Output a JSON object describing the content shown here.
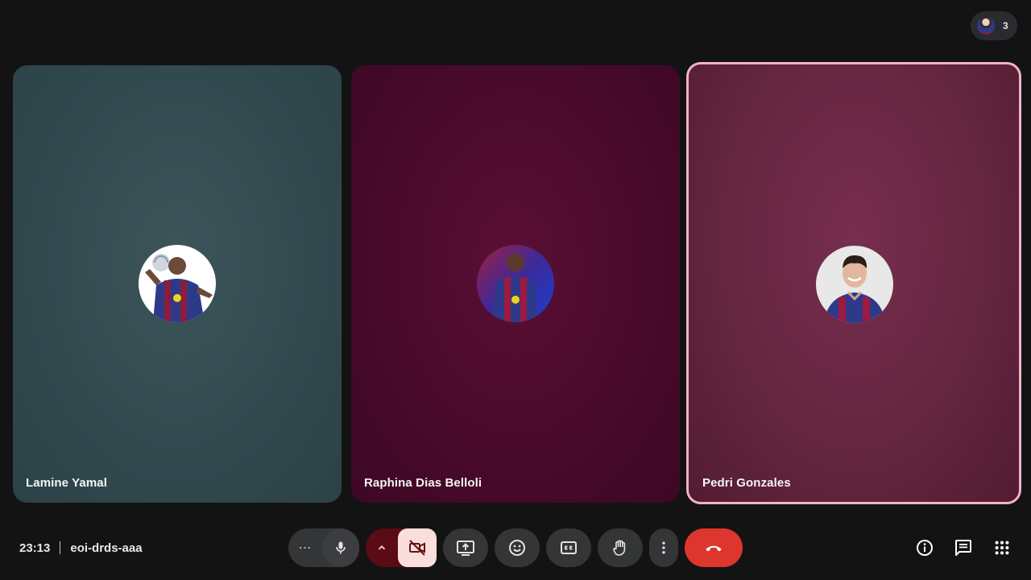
{
  "participants_chip": {
    "count": "3",
    "icon": "participant-avatar"
  },
  "tiles": [
    {
      "name": "Lamine Yamal",
      "background": "#324a4f",
      "jersey": [
        "#2d3a8a",
        "#8a1c3c"
      ],
      "avatar_bg": "#ffffff",
      "skin": "#6b4a3a"
    },
    {
      "name": "Raphina Dias Belloli",
      "background": "#4a0a2b",
      "jersey": [
        "#2d3a8a",
        "#a0193f"
      ],
      "avatar_bg": "#2e46c8",
      "skin": "#5a3a2c"
    },
    {
      "name": "Pedri Gonzales",
      "background": "#652640",
      "border": "#f2b3c5",
      "jersey": [
        "#2d3a8a",
        "#a0193f"
      ],
      "avatar_bg": "#e8e8e8",
      "skin": "#e2b79d"
    }
  ],
  "meeting": {
    "time": "23:13",
    "code": "eoi-drds-aaa"
  },
  "controls": {
    "more_options_glyph": "⋯",
    "icons": [
      "microphone-icon",
      "chevron-up-icon",
      "camera-off-icon",
      "present-screen-icon",
      "emoji-icon",
      "captions-icon",
      "raise-hand-icon",
      "more-vert-icon",
      "leave-call-icon"
    ],
    "leave_color": "#dc362e",
    "camera_off_bg": "#f9dedc"
  },
  "right_icons": [
    "info-icon",
    "chat-icon",
    "apps-icon"
  ]
}
